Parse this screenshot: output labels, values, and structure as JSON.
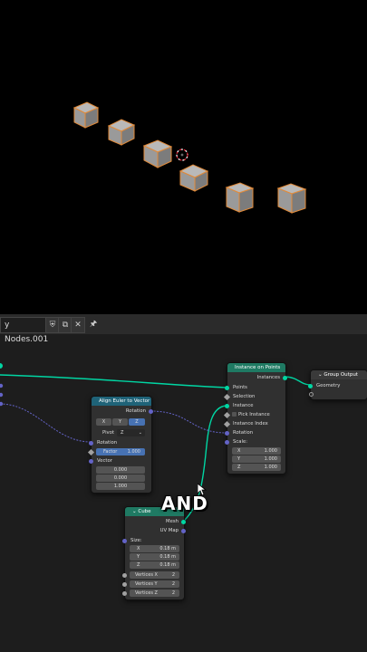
{
  "header": {
    "nodegroup_name": "y Nodes.001"
  },
  "subtitle": "AND",
  "colors": {
    "geometry": "#00d6a3",
    "vector": "#6363c7",
    "value": "#a1a1a1",
    "node_header_geo": "#1f7a63",
    "node_header_util": "#1f6378"
  },
  "align_euler": {
    "title": "Align Euler to Vector",
    "out_rotation": "Rotation",
    "axes": [
      "X",
      "Y",
      "Z"
    ],
    "selected_axis": "Z",
    "pivot_label": "Pivot",
    "pivot_value": "Z",
    "rotation_label": "Rotation",
    "factor_label": "Factor",
    "factor_value": "1.000",
    "vector_label": "Vector",
    "vector_values": [
      "0.000",
      "0.000",
      "1.000"
    ]
  },
  "instance_on_points": {
    "title": "Instance on Points",
    "out_instances": "Instances",
    "points": "Points",
    "selection": "Selection",
    "instance": "Instance",
    "pick_instance": "Pick Instance",
    "instance_index": "Instance Index",
    "rotation": "Rotation",
    "scale": "Scale:",
    "scale_values": [
      {
        "axis": "X",
        "value": "1.000"
      },
      {
        "axis": "Y",
        "value": "1.000"
      },
      {
        "axis": "Z",
        "value": "1.000"
      }
    ]
  },
  "group_output": {
    "title": "Group Output",
    "geometry": "Geometry"
  },
  "cube": {
    "title": "Cube",
    "out_mesh": "Mesh",
    "out_uv": "UV Map",
    "size_label": "Size:",
    "size": [
      {
        "axis": "X",
        "value": "0.18 m"
      },
      {
        "axis": "Y",
        "value": "0.18 m"
      },
      {
        "axis": "Z",
        "value": "0.18 m"
      }
    ],
    "vertices": [
      {
        "label": "Vertices X",
        "value": "2"
      },
      {
        "label": "Vertices Y",
        "value": "2"
      },
      {
        "label": "Vertices Z",
        "value": "2"
      }
    ]
  }
}
